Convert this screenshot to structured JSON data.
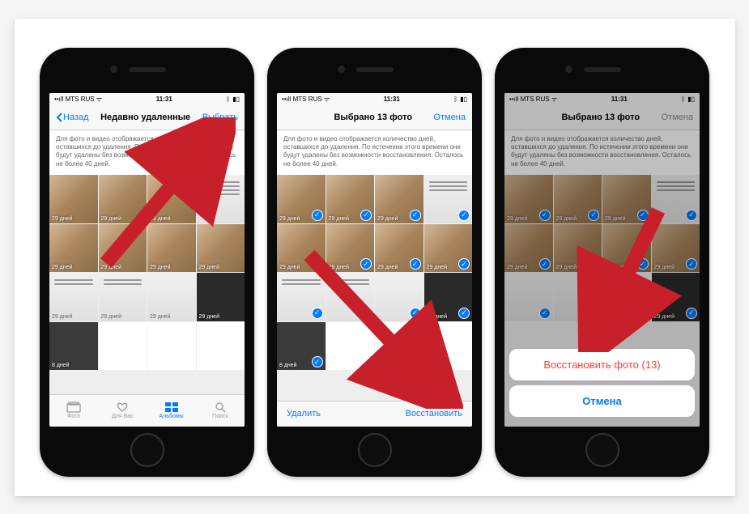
{
  "status": {
    "carrier_signal": "••ıll",
    "carrier": "MTS RUS",
    "wifi": "ᯤ",
    "time": "11:31",
    "bluetooth": "ᛒ",
    "battery": "▮▯"
  },
  "phone1": {
    "back": "Назад",
    "title": "Недавно удаленные",
    "action": "Выбрать",
    "tabs": {
      "photo": "Фото",
      "for_you": "Для Вас",
      "albums": "Альбомы",
      "search": "Поиск"
    }
  },
  "phone2": {
    "title": "Выбрано 13 фото",
    "action": "Отмена",
    "delete": "Удалить",
    "restore": "Восстановить"
  },
  "phone3": {
    "title": "Выбрано 13 фото",
    "action": "Отмена",
    "restore_n": "Восстановить фото (13)",
    "cancel": "Отмена"
  },
  "info": "Для фото и видео отображается количество дней, оставшихся до удаления. По истечении этого времени они будут удалены без возможности восстановления. Осталось не более 40 дней.",
  "thumbs": {
    "days": "29 дней",
    "days8": "8 дней"
  }
}
